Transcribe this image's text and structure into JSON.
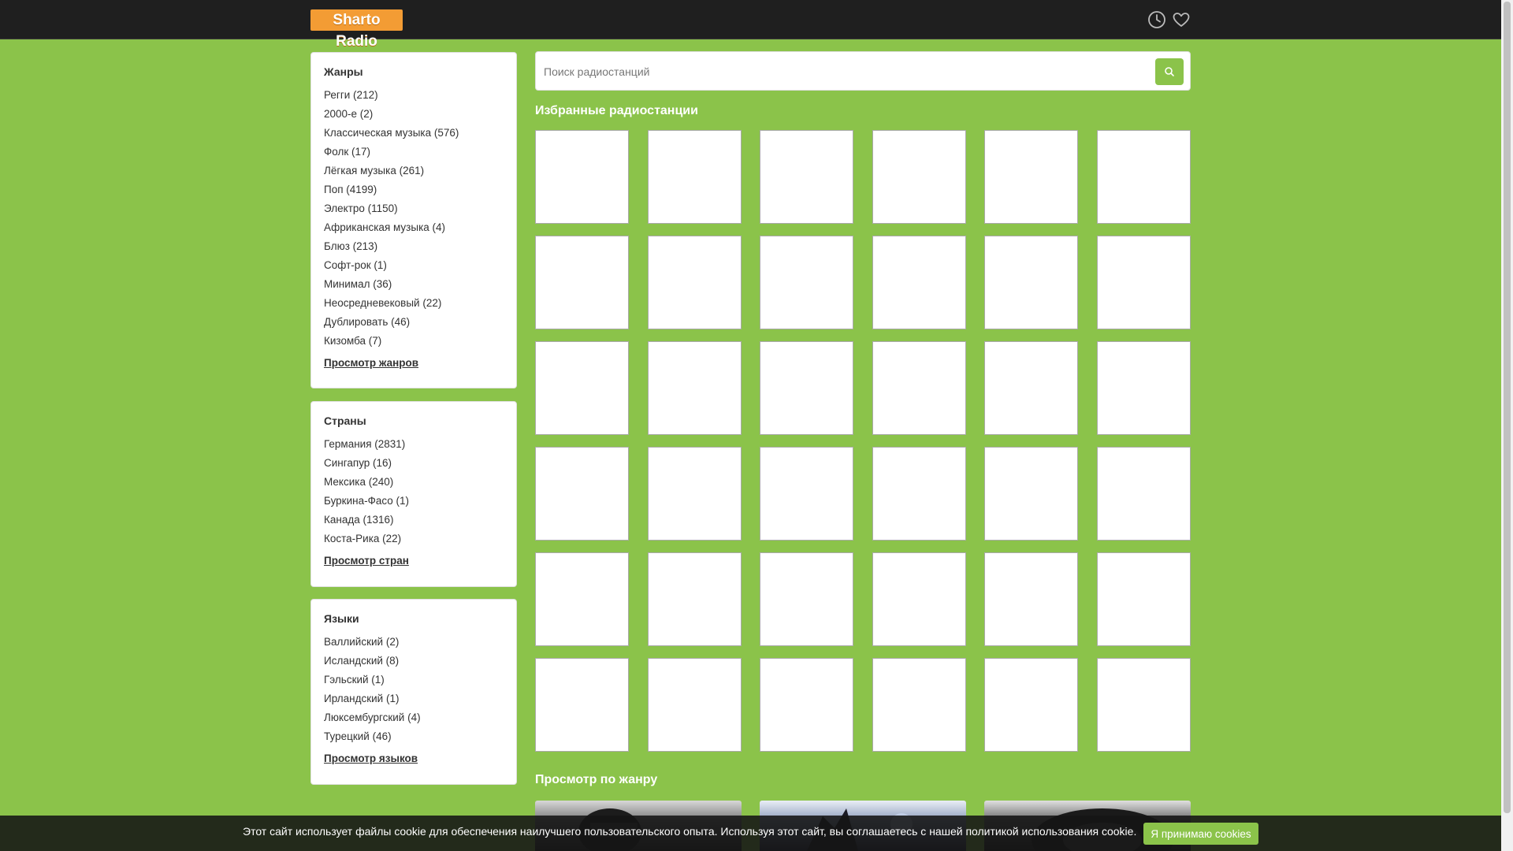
{
  "brand": {
    "logo_text": "Sharto Radio",
    "accent_color": "#8bc34a",
    "logo_color": "#f39c34"
  },
  "header": {
    "icons": [
      "clock-icon",
      "heart-icon"
    ]
  },
  "genres": {
    "title": "Жанры",
    "items": [
      "Регги (212)",
      "2000-е (2)",
      "Классическая музыка (576)",
      "Фолк (17)",
      "Лёгкая музыка (261)",
      "Поп (4199)",
      "Электро (1150)",
      "Африканская музыка (4)",
      "Блюз (213)",
      "Софт-рок (1)",
      "Минимал (36)",
      "Неосредневековый (22)",
      "Дублировать (46)",
      "Кизомба (7)"
    ],
    "more": "Просмотр жанров"
  },
  "countries": {
    "title": "Страны",
    "items": [
      "Германия (2831)",
      "Сингапур (16)",
      "Мексика (240)",
      "Буркина-Фасо (1)",
      "Канада (1316)",
      "Коста-Рика (22)"
    ],
    "more": "Просмотр стран"
  },
  "languages": {
    "title": "Языки",
    "items": [
      "Валлийский (2)",
      "Исландский (8)",
      "Гэльский (1)",
      "Ирландский (1)",
      "Люксембургский (4)",
      "Турецкий (46)"
    ],
    "more": "Просмотр языков"
  },
  "search": {
    "placeholder": "Поиск радиостанций",
    "button_icon": "search-icon"
  },
  "featured": {
    "title": "Избранные радиостанции",
    "tile_count": 36
  },
  "browse_genre": {
    "title": "Просмотр по жанру"
  },
  "cookie": {
    "text": "Этот сайт использует файлы cookie для обеспечения наилучшего пользовательского опыта. Используя этот сайт, вы соглашаетесь с нашей политикой использования cookie.",
    "button": "Я принимаю cookies"
  }
}
